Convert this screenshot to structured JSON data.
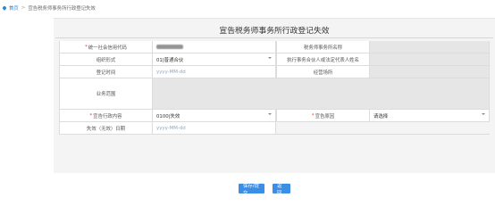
{
  "breadcrumb": {
    "home": "首页",
    "separator": ">",
    "current": "宣告税务师事务所行政登记失效"
  },
  "page_title": "宣告税务师事务所行政登记失效",
  "form": {
    "row1": {
      "credit_code_label": "统一社会信用代码",
      "credit_code_value": "",
      "firm_name_label": "税务师事务所名称",
      "firm_name_value": ""
    },
    "row2": {
      "org_form_label": "组织形式",
      "org_form_value": "01|普通合伙",
      "partner_label": "执行事务合伙人或法定代表人姓名",
      "partner_value": ""
    },
    "row3": {
      "reg_time_label": "登记时间",
      "reg_time_placeholder": "yyyy-MM-dd",
      "office_label": "经营场所",
      "office_value": ""
    },
    "row4": {
      "scope_label": "业务范围",
      "scope_value": ""
    },
    "row5": {
      "action_label": "宣告行政内容",
      "action_value": "0100|失效",
      "reason_label": "宣告原因",
      "reason_value": "请选择"
    },
    "row6": {
      "invalid_date_label": "失效（无效）日期",
      "invalid_date_placeholder": "yyyy-MM-dd"
    },
    "required_mark": "*"
  },
  "buttons": {
    "save": "保存/提交",
    "back": "返回"
  },
  "colors": {
    "accent": "#3a8ee6",
    "required": "#e0322a",
    "readonly_bg": "#e6e6e6"
  }
}
